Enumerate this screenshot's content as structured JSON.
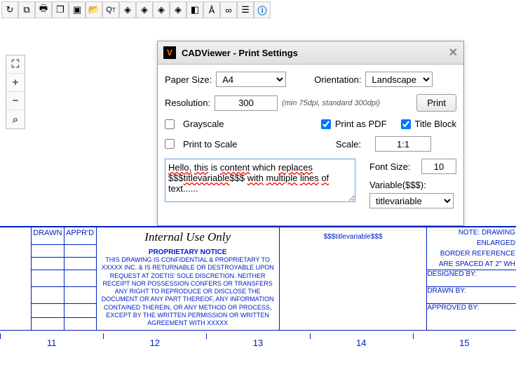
{
  "toolbarIcons": [
    "arrow-refresh",
    "copy",
    "print",
    "multi-page",
    "stack",
    "folder-open",
    "magnify-text",
    "layer-back",
    "layer-mid",
    "layer-fwd",
    "layer-front",
    "eraser",
    "compass",
    "link",
    "list",
    "info"
  ],
  "sideIcons": {
    "fullscreen": "⛶",
    "zoomIn": "+",
    "zoomOut": "−",
    "zoomTool": "⌕"
  },
  "dialog": {
    "title": "CADViewer - Print Settings",
    "paperSizeLabel": "Paper Size:",
    "paperSize": "A4",
    "orientationLabel": "Orientation:",
    "orientation": "Landscape",
    "resolutionLabel": "Resolution:",
    "resolution": "300",
    "resolutionHint": "(min 75dpi, standard 300dpi)",
    "printBtn": "Print",
    "grayscale": {
      "label": "Grayscale",
      "checked": false
    },
    "printAsPdf": {
      "label": "Print as PDF",
      "checked": true
    },
    "titleBlock": {
      "label": "Title Block",
      "checked": true
    },
    "printToScale": {
      "label": "Print to Scale",
      "checked": false
    },
    "scaleLabel": "Scale:",
    "scale": "1:1",
    "replacementText": "Hello, this is content which replaces $$$titlevariable$$$ with multiple lines of text......",
    "fontSizeLabel": "Font Size:",
    "fontSize": "10",
    "variableLabel": "Variable($$$):",
    "variable": "titlevariable"
  },
  "titleBlock": {
    "col1": "DRAWN",
    "col2": "APPR'D",
    "header": "Internal Use Only",
    "noticeTitle": "PROPRIETARY NOTICE",
    "noticeBody": "THIS DRAWING IS CONFIDENTIAL & PROPRIETARY TO XXXXX INC. & IS RETURNABLE OR DESTROYABLE UPON REQUEST AT ZOETIS' SOLE DISCRETION. NEITHER RECEIPT NOR POSSESSION CONFERS OR TRANSFERS ANY RIGHT TO REPRODUCE OR DISCLOSE THE DOCUMENT OR ANY PART THEREOF, ANY INFORMATION CONTAINED THEREIN, OR ANY METHOD OR PROCESS, EXCEPT BY THE WRITTEN PERMISSION OR WRITTEN AGREEMENT WITH XXXXX",
    "varPlaceholder": "$$$titlevariable$$$",
    "note1": "NOTE: DRAWING",
    "note2": "ENLARGED",
    "note3": "BORDER REFERENCE",
    "note4": "ARE SPACED AT 2\" WH",
    "designedBy": "DESIGNED BY:",
    "drawnBy": "DRAWN BY:",
    "approvedBy": "APPROVED BY:"
  },
  "ruler": [
    "11",
    "12",
    "13",
    "14",
    "15"
  ]
}
